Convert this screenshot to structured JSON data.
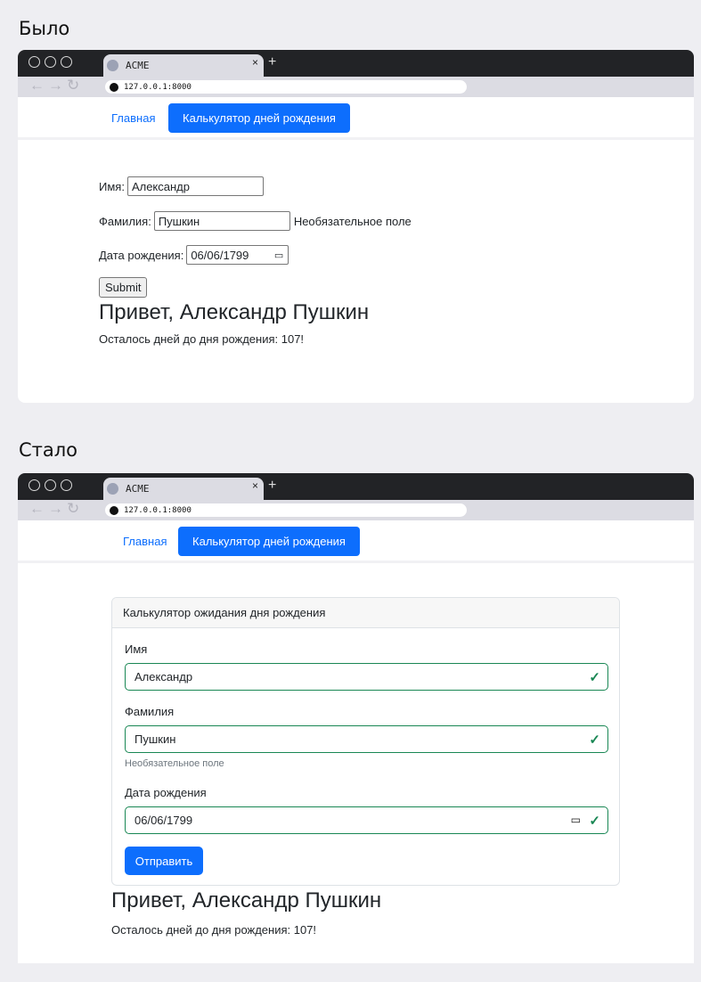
{
  "before": {
    "section_label": "Было",
    "browser": {
      "tab_title": "ACME",
      "tab_close": "×",
      "tab_new": "+",
      "nav_buttons": "←→↻",
      "url": "127.0.0.1:8000"
    },
    "nav": {
      "home": "Главная",
      "active": "Калькулятор дней рождения"
    },
    "form": {
      "first_name_label": "Имя:",
      "first_name_value": "Александр",
      "last_name_label": "Фамилия:",
      "last_name_value": "Пушкин",
      "last_name_hint": "Необязательное поле",
      "birthdate_label": "Дата рождения:",
      "birthdate_value": "06/06/1799",
      "submit_label": "Submit"
    },
    "result": {
      "greeting": "Привет, Александр Пушкин",
      "days_left": "Осталось дней до дня рождения: 107!"
    }
  },
  "after": {
    "section_label": "Стало",
    "browser": {
      "tab_title": "ACME",
      "tab_close": "×",
      "tab_new": "+",
      "nav_buttons": "←→↻",
      "url": "127.0.0.1:8000"
    },
    "nav": {
      "home": "Главная",
      "active": "Калькулятор дней рождения"
    },
    "card_title": "Калькулятор ожидания дня рождения",
    "form": {
      "first_name_label": "Имя",
      "first_name_value": "Александр",
      "last_name_label": "Фамилия",
      "last_name_value": "Пушкин",
      "last_name_hint": "Необязательное поле",
      "birthdate_label": "Дата рождения",
      "birthdate_value": "06/06/1799",
      "submit_label": "Отправить"
    },
    "result": {
      "greeting": "Привет, Александр Пушкин",
      "days_left": "Осталось дней до дня рождения: 107!"
    }
  },
  "icons": {
    "valid_check": "check-icon",
    "calendar": "calendar-icon",
    "accent_color": "#0d6efd",
    "valid_color": "#198754"
  }
}
